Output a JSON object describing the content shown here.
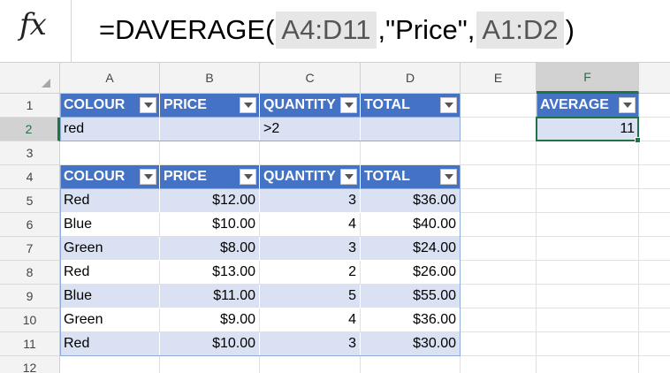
{
  "formula_bar": {
    "fx_label": "fx",
    "parts": [
      {
        "text": "=DAVERAGE(",
        "ref": false
      },
      {
        "text": "A4:D11",
        "ref": true
      },
      {
        "text": ",\"Price\",",
        "ref": false
      },
      {
        "text": "A1:D2",
        "ref": true
      },
      {
        "text": ")",
        "ref": false
      }
    ]
  },
  "columns": [
    "A",
    "B",
    "C",
    "D",
    "E",
    "F"
  ],
  "active_column": "F",
  "rows": [
    "1",
    "2",
    "3",
    "4",
    "5",
    "6",
    "7",
    "8",
    "9",
    "10",
    "11",
    "12"
  ],
  "active_row": "2",
  "criteria_table": {
    "headers": [
      "COLOUR",
      "PRICE",
      "QUANTITY",
      "TOTAL"
    ],
    "values": [
      "red",
      "",
      ">2",
      ""
    ]
  },
  "data_table": {
    "headers": [
      "COLOUR",
      "PRICE",
      "QUANTITY",
      "TOTAL"
    ],
    "rows": [
      [
        "Red",
        "$12.00",
        "3",
        "$36.00"
      ],
      [
        "Blue",
        "$10.00",
        "4",
        "$40.00"
      ],
      [
        "Green",
        "$8.00",
        "3",
        "$24.00"
      ],
      [
        "Red",
        "$13.00",
        "2",
        "$26.00"
      ],
      [
        "Blue",
        "$11.00",
        "5",
        "$55.00"
      ],
      [
        "Green",
        "$9.00",
        "4",
        "$36.00"
      ],
      [
        "Red",
        "$10.00",
        "3",
        "$30.00"
      ]
    ]
  },
  "result_table": {
    "header": "AVERAGE",
    "value": "11"
  },
  "colors": {
    "table_header": "#4472c4",
    "table_band": "#d9e1f2",
    "selection": "#217346"
  }
}
